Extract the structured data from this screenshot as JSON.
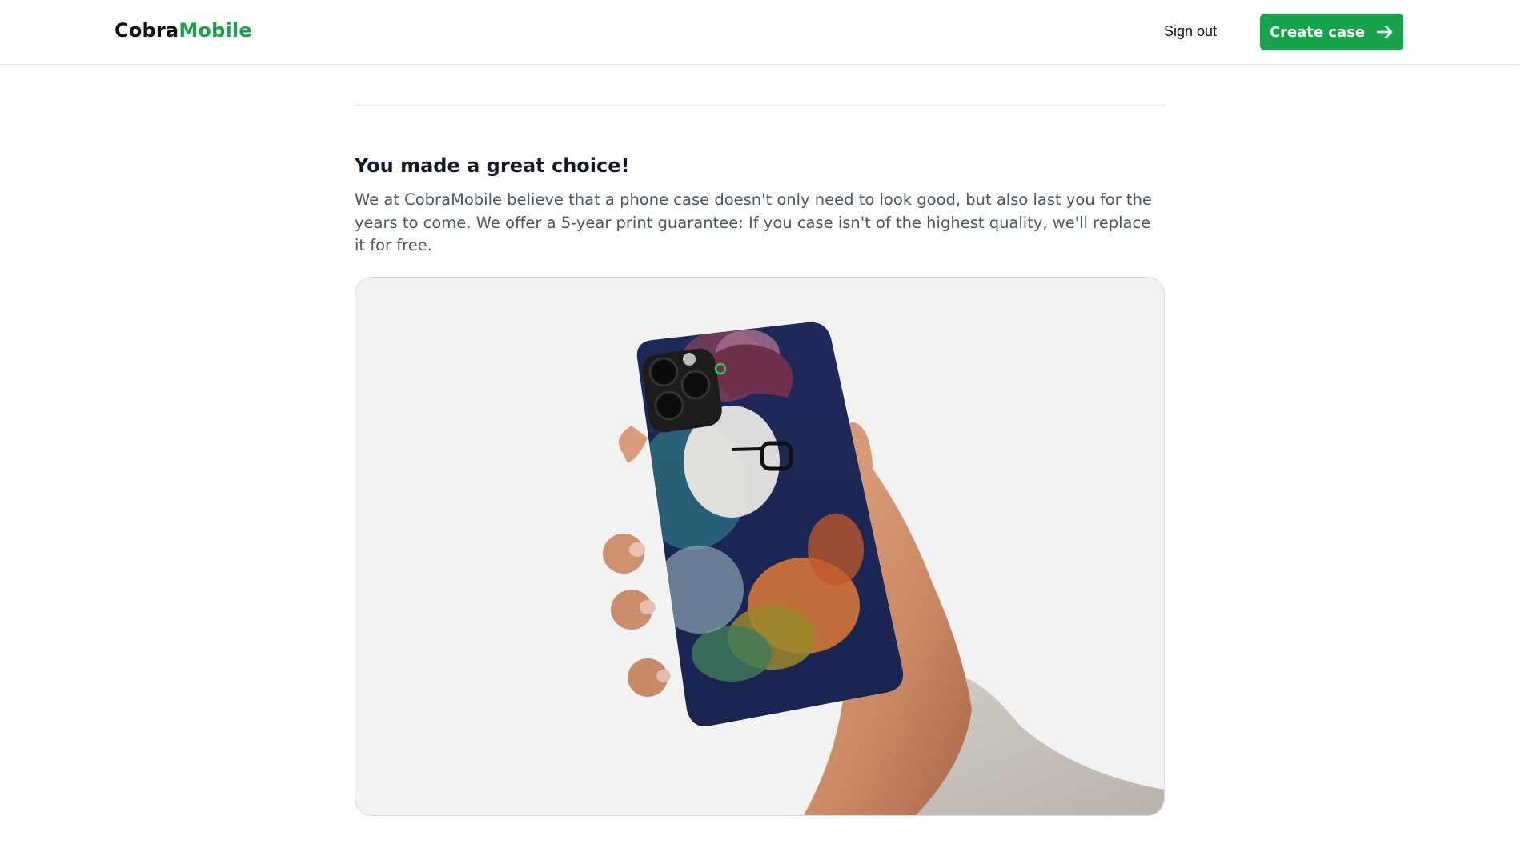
{
  "navbar": {
    "logo_primary": "Cobra",
    "logo_accent": "Mobile",
    "sign_out_label": "Sign out",
    "create_case_label": "Create case"
  },
  "section": {
    "heading": "You made a great choice!",
    "description": "We at CobraMobile believe that a phone case doesn't only need to look good, but also last you for the years to come. We offer a 5-year print guarantee: If you case isn't of the highest quality, we'll replace it for free."
  },
  "image": {
    "subject": "hand holding phone with custom printed case"
  },
  "colors": {
    "brand_green": "#16a34a",
    "card_bg": "#f2f2f2",
    "text_muted": "#4b5563"
  }
}
